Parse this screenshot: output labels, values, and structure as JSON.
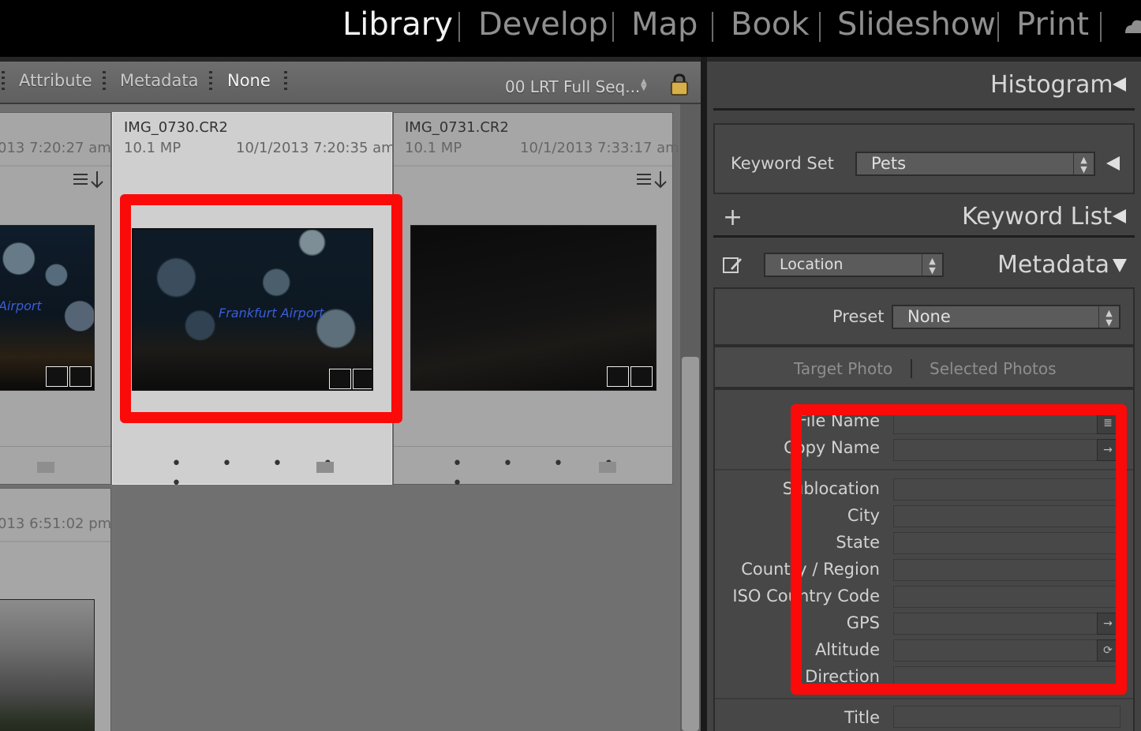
{
  "modules": [
    {
      "label": "Library",
      "active": true
    },
    {
      "label": "Develop",
      "active": false
    },
    {
      "label": "Map",
      "active": false
    },
    {
      "label": "Book",
      "active": false
    },
    {
      "label": "Slideshow",
      "active": false
    },
    {
      "label": "Print",
      "active": false
    }
  ],
  "filter_bar": {
    "items": [
      "Attribute",
      "Metadata",
      "None"
    ],
    "active": "None",
    "preset": "00 LRT Full Seq..."
  },
  "grid": {
    "cells": [
      {
        "date_fragment": "013 7:20:27 am",
        "caption": "Airport"
      },
      {
        "name": "IMG_0730.CR2",
        "mp": "10.1 MP",
        "date": "10/1/2013 7:20:35 am",
        "caption": "Frankfurt Airport",
        "selected": true
      },
      {
        "name": "IMG_0731.CR2",
        "mp": "10.1 MP",
        "date": "10/1/2013 7:33:17 am"
      },
      {
        "date_fragment": "013 6:51:02 pm"
      }
    ],
    "rating_dots": "• • • • •"
  },
  "right_panel": {
    "histogram_title": "Histogram",
    "keyword_set_label": "Keyword Set",
    "keyword_set_value": "Pets",
    "keyword_list_title": "Keyword List",
    "metadata_title": "Metadata",
    "metadata_preset_select": "Location",
    "preset_label": "Preset",
    "preset_value": "None",
    "tab_target": "Target Photo",
    "tab_selected": "Selected Photos",
    "fields": [
      "File Name",
      "Copy Name",
      "Sublocation",
      "City",
      "State",
      "Country / Region",
      "ISO Country Code",
      "GPS",
      "Altitude",
      "Direction",
      "Title"
    ]
  },
  "colors": {
    "highlight": "#fb0a0a",
    "panel_bg": "#424242",
    "grid_bg": "#707070",
    "selected_cell": "#cfcfcf"
  }
}
